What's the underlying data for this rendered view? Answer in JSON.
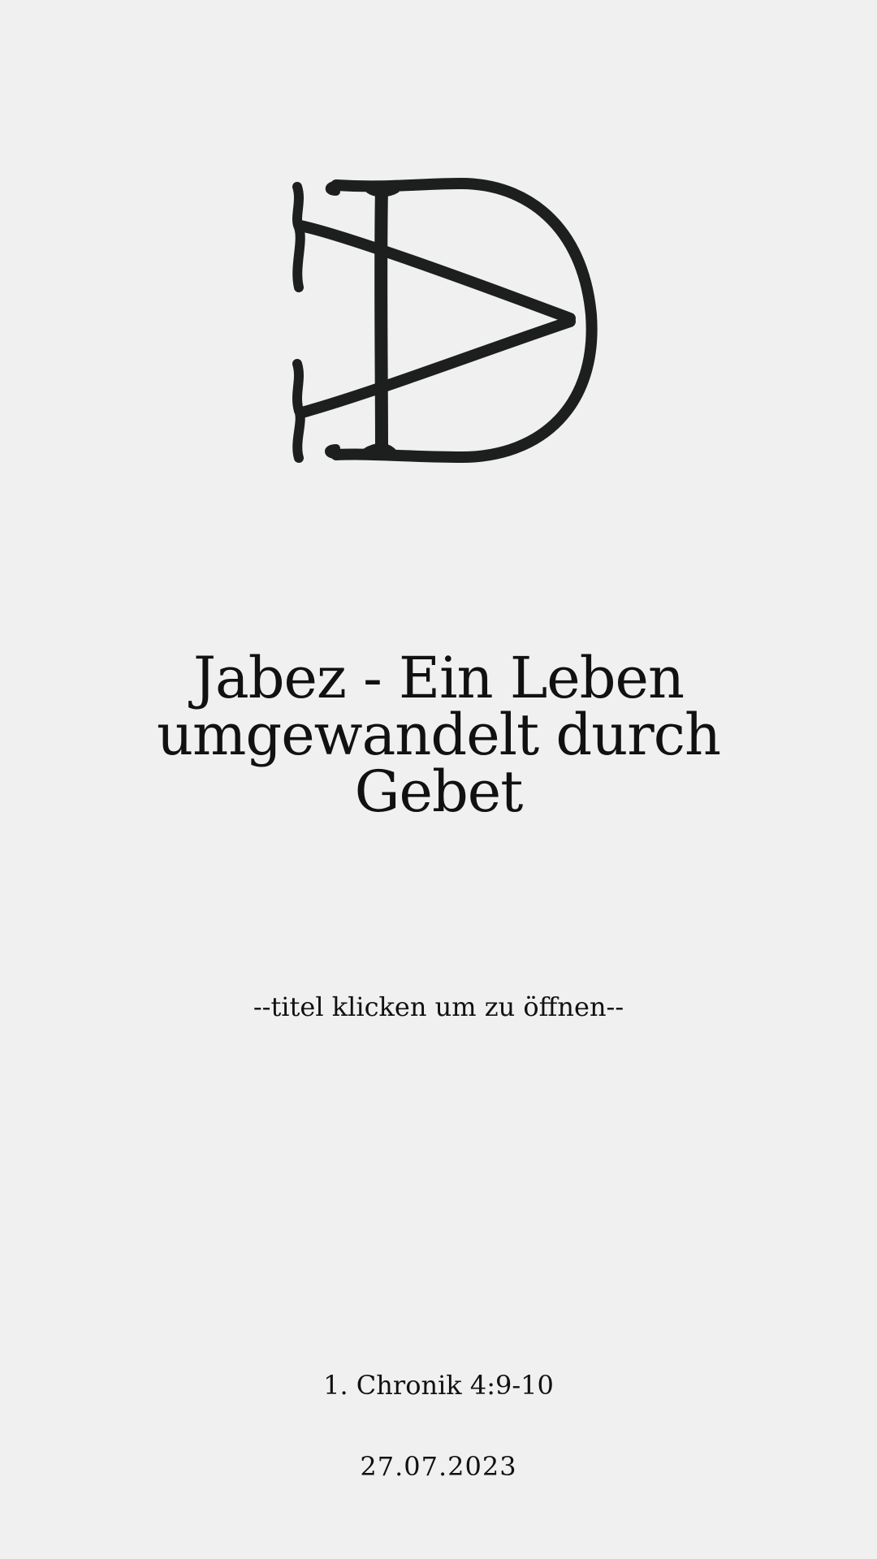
{
  "logo": {
    "icon": "jd-monogram-icon",
    "color": "#1c1f1e"
  },
  "cover": {
    "title": "Jabez - Ein Leben umgewandelt durch Gebet",
    "hint": "--titel klicken um zu öffnen--",
    "reference": "1. Chronik 4:9-10",
    "date": "27.07.2023"
  },
  "colors": {
    "background": "#f0f0f0",
    "text": "#111111"
  }
}
